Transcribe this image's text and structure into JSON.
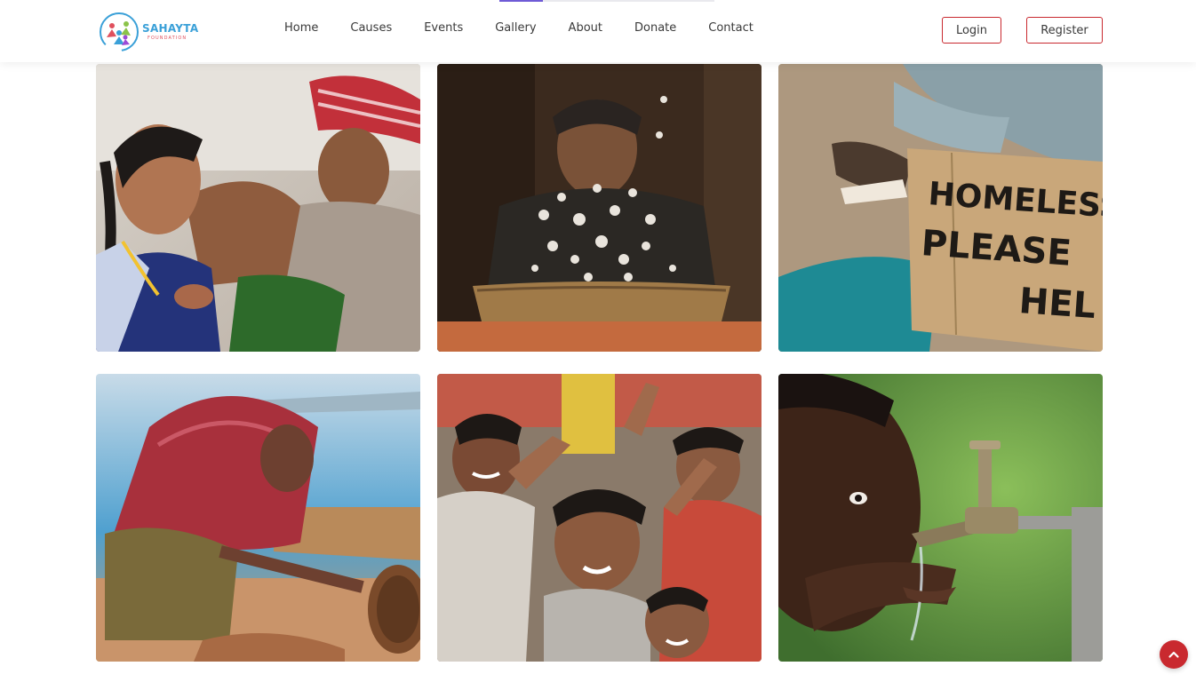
{
  "brand": {
    "name": "SAHAYTA",
    "tagline": "FOUNDATION",
    "logo_icon": "people-star-logo-icon"
  },
  "nav": {
    "items": [
      {
        "label": "Home"
      },
      {
        "label": "Causes"
      },
      {
        "label": "Events"
      },
      {
        "label": "Gallery"
      },
      {
        "label": "About"
      },
      {
        "label": "Donate"
      },
      {
        "label": "Contact"
      }
    ]
  },
  "auth": {
    "login_label": "Login",
    "register_label": "Register"
  },
  "gallery": {
    "images": [
      {
        "subject": "girl-with-man-photo"
      },
      {
        "subject": "woman-winnowing-cotton-photo"
      },
      {
        "subject": "homeless-please-help-sign-photo",
        "sign_text": "HOMELESS PLEASE HEL"
      },
      {
        "subject": "girl-in-red-scarf-photo"
      },
      {
        "subject": "smiling-children-photo"
      },
      {
        "subject": "child-drinking-from-tap-photo"
      }
    ]
  },
  "back_to_top": {
    "icon": "chevron-up-icon"
  },
  "colors": {
    "accent_red": "#c9292f",
    "brand_blue": "#3aa0d8",
    "brand_pink": "#e0505d",
    "active_indicator": "#6f5bd6"
  }
}
